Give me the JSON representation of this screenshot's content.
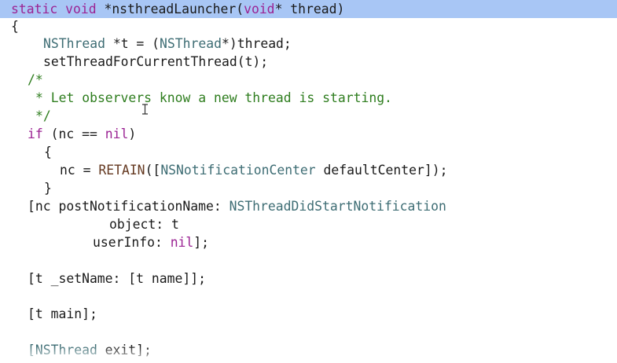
{
  "editor": {
    "lines": [
      {
        "tokens": [
          {
            "t": "static",
            "c": "kw"
          },
          {
            "t": " "
          },
          {
            "t": "void",
            "c": "kw"
          },
          {
            "t": " *nsthreadLauncher("
          },
          {
            "t": "void",
            "c": "kw"
          },
          {
            "t": "* thread)"
          }
        ]
      },
      {
        "tokens": [
          {
            "t": "{"
          }
        ]
      },
      {
        "tokens": [
          {
            "t": "NSThread",
            "c": "ty"
          },
          {
            "t": " *t = ("
          },
          {
            "t": "NSThread",
            "c": "ty"
          },
          {
            "t": "*)thread;"
          }
        ]
      },
      {
        "tokens": [
          {
            "t": "setThreadForCurrentThread(t);"
          }
        ]
      },
      {
        "tokens": [
          {
            "t": "/*",
            "c": "cm"
          }
        ]
      },
      {
        "tokens": [
          {
            "t": "* Let observers know a new thread is starting.",
            "c": "cm"
          }
        ]
      },
      {
        "tokens": [
          {
            "t": "*/",
            "c": "cm"
          }
        ]
      },
      {
        "tokens": [
          {
            "t": "if",
            "c": "kw"
          },
          {
            "t": " (nc == "
          },
          {
            "t": "nil",
            "c": "kw"
          },
          {
            "t": ")"
          }
        ]
      },
      {
        "tokens": [
          {
            "t": "{"
          }
        ]
      },
      {
        "tokens": [
          {
            "t": "nc = "
          },
          {
            "t": "RETAIN",
            "c": "ma"
          },
          {
            "t": "(["
          },
          {
            "t": "NSNotificationCenter",
            "c": "ty"
          },
          {
            "t": " defaultCenter]);"
          }
        ]
      },
      {
        "tokens": [
          {
            "t": "}"
          }
        ]
      },
      {
        "tokens": [
          {
            "t": "[nc postNotificationName: "
          },
          {
            "t": "NSThreadDidStartNotification",
            "c": "ty"
          }
        ]
      },
      {
        "tokens": [
          {
            "t": "object: t"
          }
        ]
      },
      {
        "tokens": [
          {
            "t": "userInfo: "
          },
          {
            "t": "nil",
            "c": "kw"
          },
          {
            "t": "];"
          }
        ]
      },
      {
        "tokens": []
      },
      {
        "tokens": [
          {
            "t": "[t _setName: [t name]];"
          }
        ]
      },
      {
        "tokens": []
      },
      {
        "tokens": [
          {
            "t": "[t main];"
          }
        ]
      },
      {
        "tokens": []
      },
      {
        "tokens": [
          {
            "t": "[NSThread",
            "c": "ty"
          },
          {
            "t": " exit];"
          }
        ]
      }
    ]
  }
}
